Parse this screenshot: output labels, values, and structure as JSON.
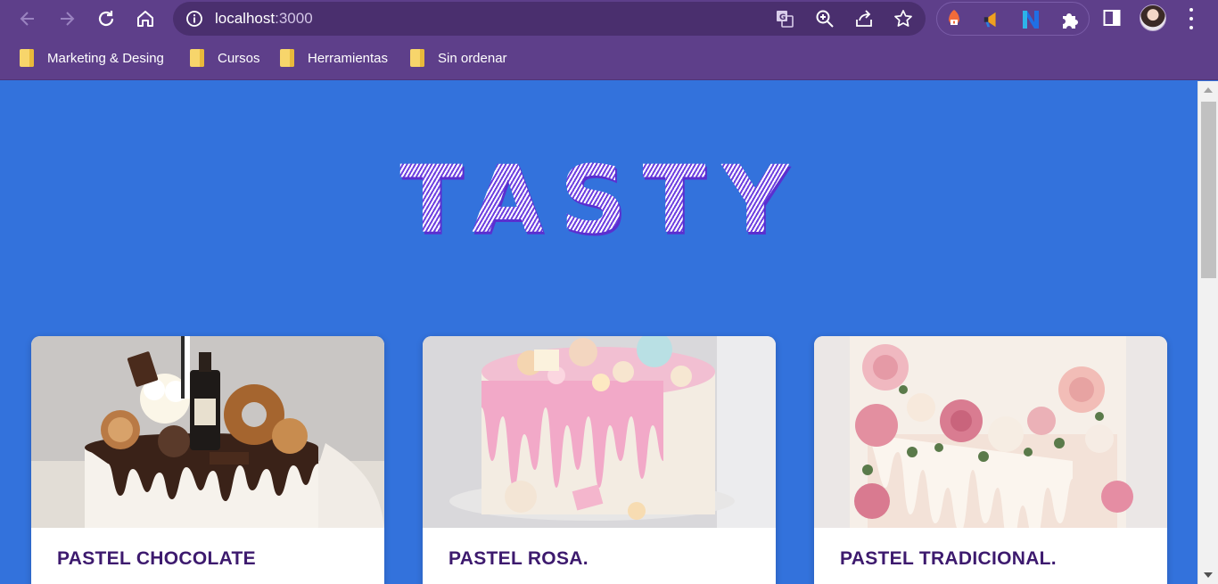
{
  "browser": {
    "url_host": "localhost",
    "url_port": ":3000",
    "bookmarks": [
      {
        "label": "Marketing & Desing"
      },
      {
        "label": "Cursos"
      },
      {
        "label": "Herramientas"
      },
      {
        "label": "Sin ordenar"
      }
    ],
    "icons": {
      "back": "arrow-left-icon",
      "forward": "arrow-right-icon",
      "reload": "reload-icon",
      "home": "home-icon",
      "info": "info-icon",
      "translate": "translate-icon",
      "zoom": "zoom-icon",
      "share": "share-icon",
      "bookmark": "star-icon",
      "extensions": "puzzle-icon",
      "side_panel": "side-panel-icon",
      "menu": "kebab-menu-icon"
    },
    "colors": {
      "chrome": "#5e3f8a",
      "omnibox": "#4a2f6e"
    }
  },
  "page": {
    "hero_title": "TASTY",
    "background": "#3372dc",
    "cards": [
      {
        "title": "PASTEL CHOCOLATE"
      },
      {
        "title": "PASTEL ROSA."
      },
      {
        "title": "PASTEL TRADICIONAL."
      }
    ]
  }
}
